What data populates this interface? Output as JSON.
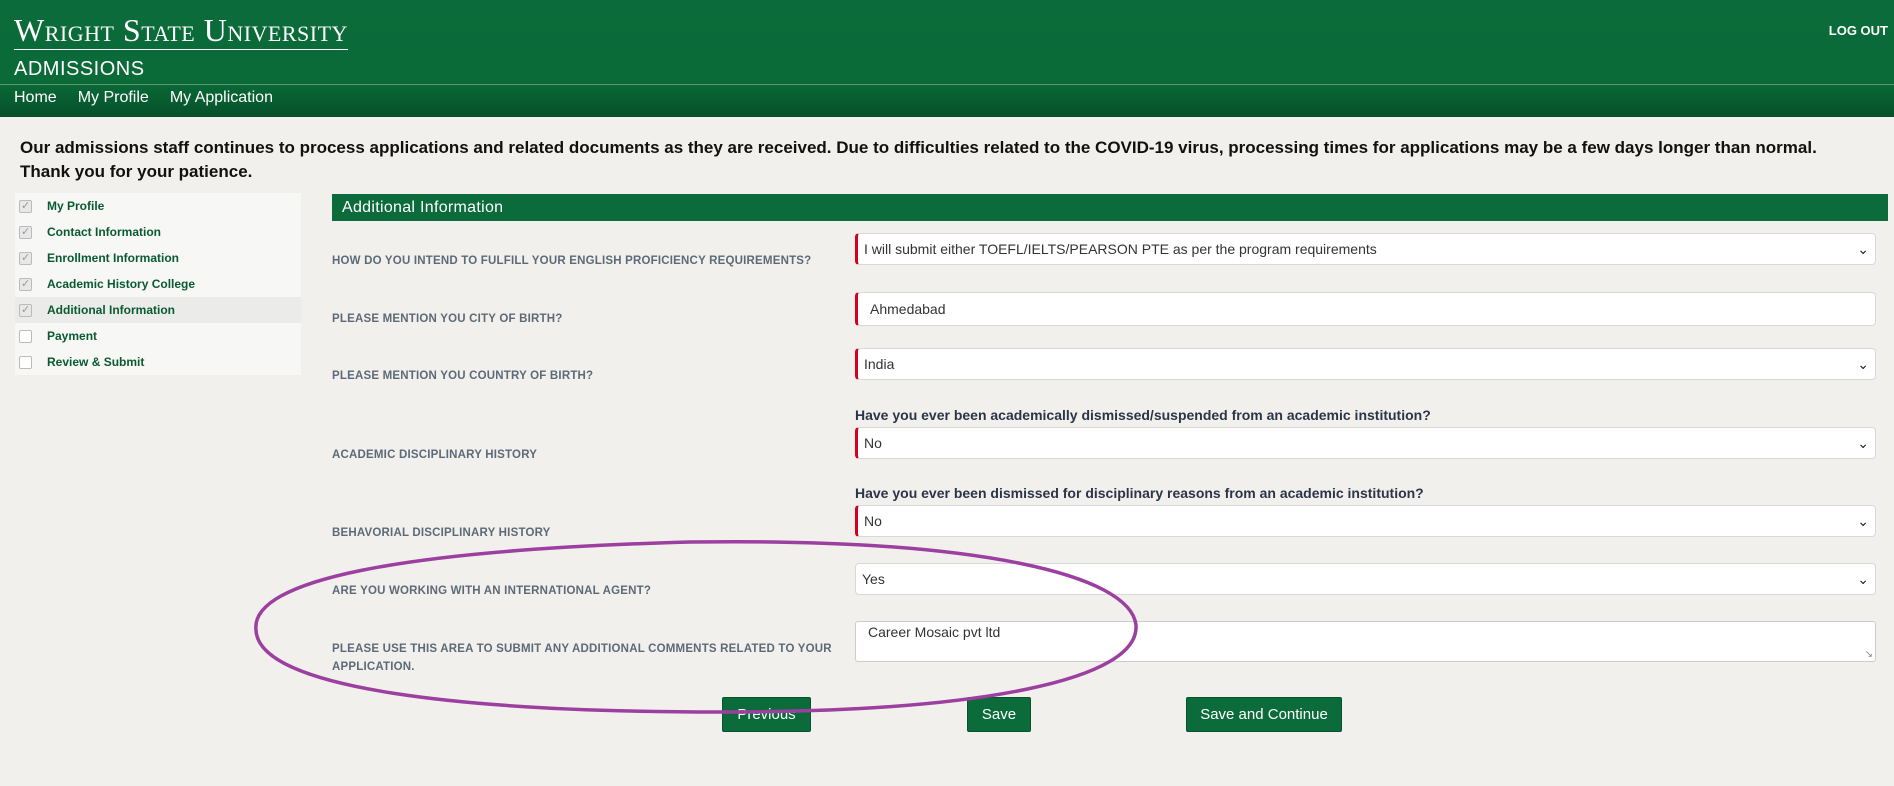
{
  "header": {
    "university": "Wright State University",
    "subtitle": "ADMISSIONS",
    "logout": "LOG OUT",
    "nav": [
      "Home",
      "My Profile",
      "My Application"
    ]
  },
  "notice": "Our admissions staff continues to process applications and related documents as they are received. Due to difficulties related to the COVID-19 virus, processing times for applications may be a few days longer than normal. Thank you for your patience.",
  "sidebar": {
    "items": [
      {
        "label": "My Profile",
        "checked": true
      },
      {
        "label": "Contact Information",
        "checked": true
      },
      {
        "label": "Enrollment Information",
        "checked": true
      },
      {
        "label": "Academic History College",
        "checked": true
      },
      {
        "label": "Additional Information",
        "checked": true
      },
      {
        "label": "Payment",
        "checked": false
      },
      {
        "label": "Review & Submit",
        "checked": false
      }
    ]
  },
  "section": {
    "title": "Additional Information"
  },
  "questions": {
    "english": {
      "label": "HOW DO YOU INTEND TO FULFILL YOUR ENGLISH PROFICIENCY REQUIREMENTS?",
      "value": "I will submit either TOEFL/IELTS/PEARSON PTE as per the program requirements"
    },
    "city": {
      "label": "PLEASE MENTION YOU CITY OF BIRTH?",
      "value": "Ahmedabad"
    },
    "country": {
      "label": "PLEASE MENTION YOU COUNTRY OF BIRTH?",
      "value": "India"
    },
    "academic": {
      "label": "ACADEMIC DISCIPLINARY HISTORY",
      "question": "Have you ever been academically dismissed/suspended from an academic institution?",
      "value": "No"
    },
    "behavioral": {
      "label": "BEHAVORIAL DISCIPLINARY HISTORY",
      "question": "Have you ever been dismissed for disciplinary reasons from an academic institution?",
      "value": "No"
    },
    "agent": {
      "label": "ARE YOU WORKING WITH AN INTERNATIONAL AGENT?",
      "value": "Yes"
    },
    "comments": {
      "label_line1": "PLEASE USE THIS AREA TO SUBMIT ANY ADDITIONAL COMMENTS RELATED TO YOUR",
      "label_line2": "APPLICATION.",
      "value": "Career Mosaic pvt ltd"
    }
  },
  "buttons": {
    "previous": "Previous",
    "save": "Save",
    "save_continue": "Save and Continue"
  },
  "icons": {
    "chevron": "chevron-down-icon",
    "checkbox": "checkbox-icon"
  },
  "colors": {
    "brand_green": "#0b6b3a",
    "required_marker": "#d6001c",
    "annotation": "#9b3fa0"
  }
}
